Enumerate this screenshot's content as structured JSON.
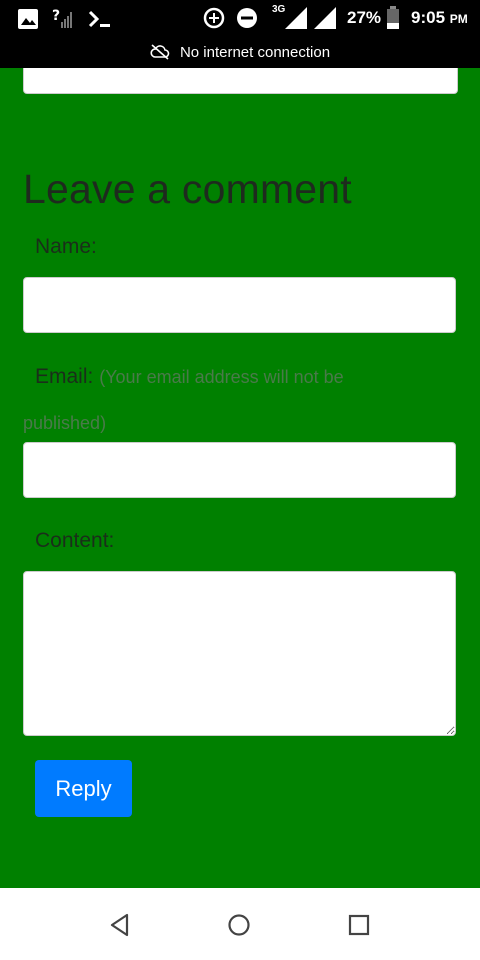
{
  "status_bar": {
    "network_type": "3G",
    "battery_percent": "27%",
    "time": "9:05",
    "time_suffix": "PM",
    "notification": "No internet connection",
    "icons": [
      "image-icon",
      "signal-unknown-icon",
      "terminal-icon",
      "data-saver-icon",
      "do-not-disturb-icon",
      "signal-icon",
      "battery-icon",
      "cloud-off-icon"
    ]
  },
  "comment_form": {
    "heading": "Leave a comment",
    "name_label": "Name:",
    "email_label": "Email:",
    "email_hint_line1": "(Your email address will not be",
    "email_hint_line2": "published)",
    "content_label": "Content:",
    "name_value": "",
    "email_value": "",
    "content_value": "",
    "reply_label": "Reply"
  },
  "nav_bar": {
    "icons": [
      "back-icon",
      "home-icon",
      "recents-icon"
    ]
  },
  "colors": {
    "page_background": "#008000",
    "button": "#007bff",
    "status_bar": "#000000"
  }
}
